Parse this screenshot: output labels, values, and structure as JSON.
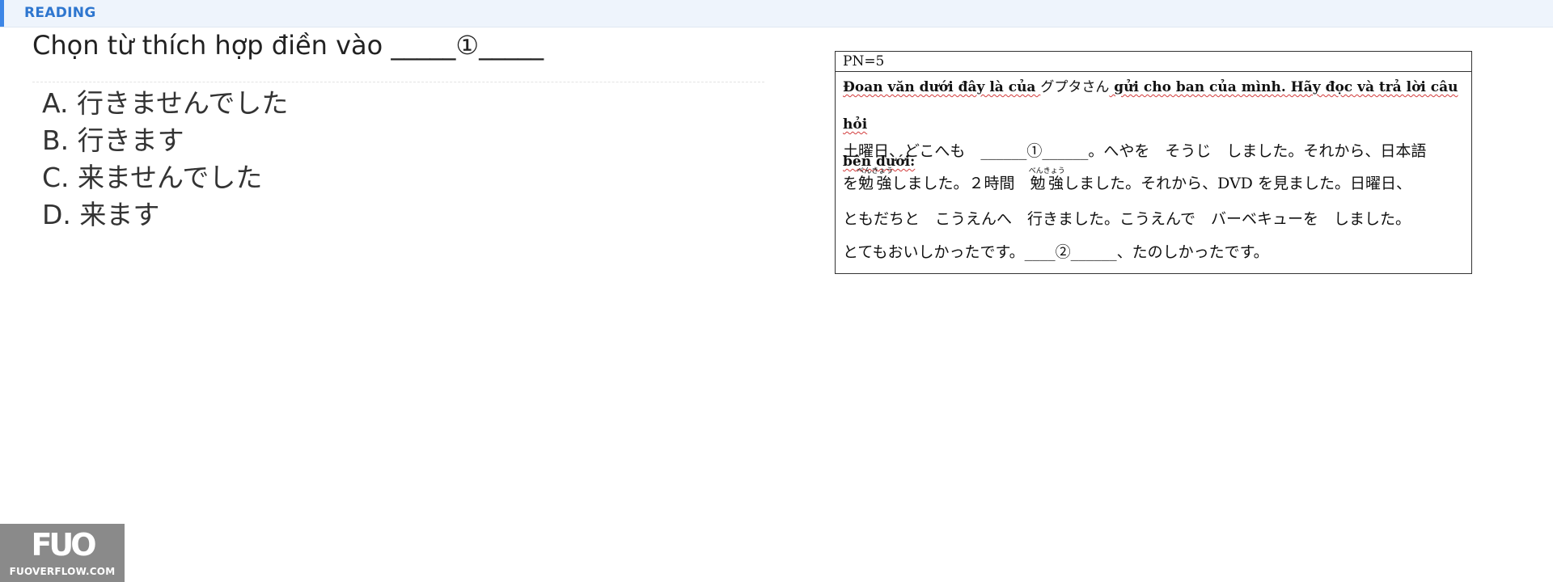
{
  "header": {
    "section_label": "READING"
  },
  "question": {
    "text": "Chọn từ thích hợp điền vào _____①_____"
  },
  "options": [
    {
      "text": "A. 行きませんでした"
    },
    {
      "text": "B. 行きます"
    },
    {
      "text": "C. 来ませんでした"
    },
    {
      "text": "D. 来ます"
    }
  ],
  "passage": {
    "header": "PN=5",
    "instruction_part1": "Đoan văn dưới đây là của ",
    "instruction_name": "グプタさん",
    "instruction_part2": " gửi cho ban của mình. Hãy đọc và trả lời câu hỏi",
    "instruction_line2": "bên dưới:",
    "line1": "土曜日、どこへも　______①______。へやを　そうじ　しました。それから、日本語",
    "line2_a": "を",
    "line2_ruby_base": "勉強",
    "line2_ruby_reading": "べんきょう",
    "line2_b": "しました。２時間　",
    "line2_c": "しました。それから、DVD を見ました。日曜日、",
    "line3": "ともだちと　こうえんへ　行きました。こうえんで　バーベキューを　しました。",
    "line4": "とてもおいしかったです。____②______、たのしかったです。"
  },
  "logo": {
    "mark": "FUO",
    "site": "FUOVERFLOW.COM"
  }
}
